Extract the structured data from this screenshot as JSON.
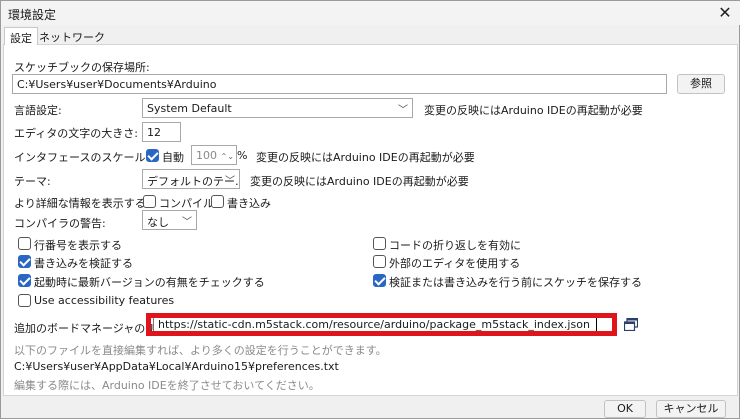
{
  "window": {
    "title": "環境設定",
    "close_glyph": "✕"
  },
  "tabs": [
    {
      "label": "設定"
    },
    {
      "label": "ネットワーク"
    }
  ],
  "sketchbook": {
    "label": "スケッチブックの保存場所:",
    "path": "C:¥Users¥user¥Documents¥Arduino",
    "browse_label": "参照"
  },
  "language": {
    "label": "言語設定:",
    "value": "System Default",
    "note": "変更の反映にはArduino IDEの再起動が必要"
  },
  "editor_font": {
    "label": "エディタの文字の大きさ:",
    "value": "12"
  },
  "ui_scale": {
    "label": "インタフェースのスケール:",
    "auto_label": "自動",
    "auto_checked": true,
    "percent_value": "100",
    "percent_sign": "%",
    "note": "変更の反映にはArduino IDEの再起動が必要"
  },
  "theme": {
    "label": "テーマ:",
    "value": "デフォルトのテー…",
    "note": "変更の反映にはArduino IDEの再起動が必要"
  },
  "verbose": {
    "label": "より詳細な情報を表示する:",
    "compile_label": "コンパイル",
    "compile_checked": false,
    "upload_label": "書き込み",
    "upload_checked": false
  },
  "warnings": {
    "label": "コンパイラの警告:",
    "value": "なし"
  },
  "options": {
    "left": [
      {
        "label": "行番号を表示する",
        "checked": false
      },
      {
        "label": "書き込みを検証する",
        "checked": true
      },
      {
        "label": "起動時に最新バージョンの有無をチェックする",
        "checked": true
      },
      {
        "label": "Use accessibility features",
        "checked": false
      }
    ],
    "right": [
      {
        "label": "コードの折り返しを有効に",
        "checked": false
      },
      {
        "label": "外部のエディタを使用する",
        "checked": false
      },
      {
        "label": "検証または書き込みを行う前にスケッチを保存する",
        "checked": true
      }
    ]
  },
  "board_manager": {
    "label": "追加のボードマネージャのURL:",
    "value": "https://static-cdn.m5stack.com/resource/arduino/package_m5stack_index.json",
    "highlight_color": "#e0151b"
  },
  "footer": {
    "hint": "以下のファイルを直接編集すれば、より多くの設定を行うことができます。",
    "prefs_path": "C:¥Users¥user¥AppData¥Local¥Arduino15¥preferences.txt",
    "note": "編集する際には、Arduino IDEを終了させておいてください。"
  },
  "buttons": {
    "ok": "OK",
    "cancel": "キャンセル"
  },
  "colors": {
    "accent": "#2a67c4",
    "highlight": "#e0151b"
  },
  "icons": [
    "close-icon",
    "chevron-down-icon",
    "checkmark-icon",
    "spinner-arrows-icon",
    "open-window-icon"
  ]
}
